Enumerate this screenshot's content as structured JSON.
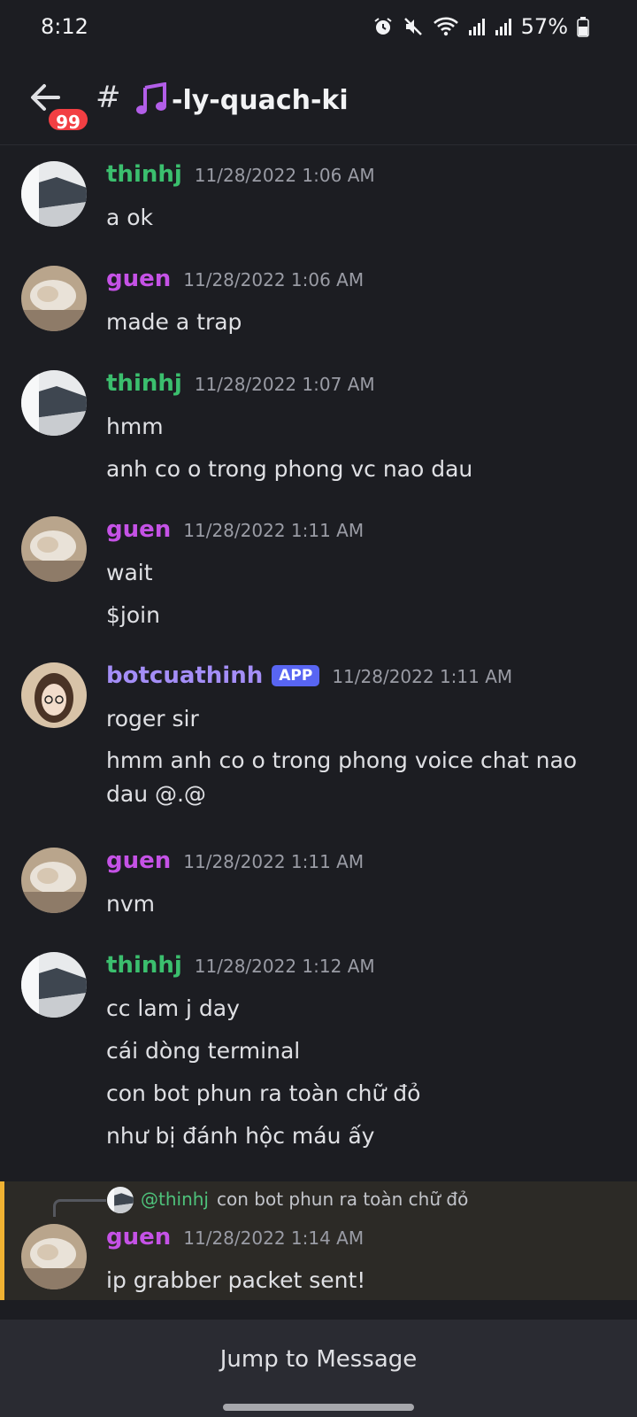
{
  "status": {
    "time": "8:12",
    "battery": "57%",
    "icons": [
      "alarm-icon",
      "mute-icon",
      "wifi-icon",
      "signal-icon",
      "signal-icon",
      "battery-icon"
    ]
  },
  "header": {
    "badge": "99",
    "hash": "#",
    "channel": "-ly-quach-ki",
    "channel_icon": "music-note-icon"
  },
  "colors": {
    "thinhj": "#3bbf6e",
    "guen": "#c552e6",
    "botcuathinh": "#a48ef7",
    "app_tag": "#5865f2",
    "reply_border": "#f0b232",
    "badge": "#f23f43"
  },
  "messages": [
    {
      "author": "thinhj",
      "timestamp": "11/28/2022 1:06 AM",
      "lines": [
        "a ok"
      ]
    },
    {
      "author": "guen",
      "timestamp": "11/28/2022 1:06 AM",
      "lines": [
        "made a trap"
      ]
    },
    {
      "author": "thinhj",
      "timestamp": "11/28/2022 1:07 AM",
      "lines": [
        "hmm",
        "anh co o trong phong vc nao dau"
      ]
    },
    {
      "author": "guen",
      "timestamp": "11/28/2022 1:11 AM",
      "lines": [
        "wait",
        "$join"
      ]
    },
    {
      "author": "botcuathinh",
      "tag": "APP",
      "timestamp": "11/28/2022 1:11 AM",
      "lines": [
        "roger sir",
        "hmm anh co o trong phong voice chat nao dau @.@"
      ]
    },
    {
      "author": "guen",
      "timestamp": "11/28/2022 1:11 AM",
      "lines": [
        "nvm"
      ]
    },
    {
      "author": "thinhj",
      "timestamp": "11/28/2022 1:12 AM",
      "lines": [
        "cc lam j day",
        "cái dòng terminal",
        "con bot phun ra toàn chữ đỏ",
        "như bị đánh hộc máu ấy"
      ]
    }
  ],
  "reply": {
    "mention": "@thinhj",
    "replied_text": "con bot phun ra toàn chữ đỏ",
    "author": "guen",
    "timestamp": "11/28/2022 1:14 AM",
    "line": "ip grabber packet sent!"
  },
  "footer": {
    "jump_label": "Jump to Message"
  }
}
